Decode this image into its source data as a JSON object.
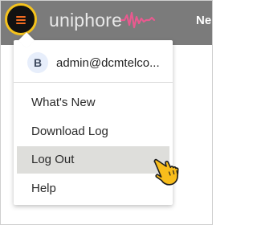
{
  "app": {
    "logo_text": "uniphore",
    "nav_partial": "Ne"
  },
  "user": {
    "avatar_initial": "B",
    "email": "admin@dcmtelco..."
  },
  "menu": {
    "items": [
      {
        "label": "What's New"
      },
      {
        "label": "Download Log"
      },
      {
        "label": "Log Out",
        "highlighted": true
      },
      {
        "label": "Help"
      }
    ]
  },
  "colors": {
    "topbar": "#7b7b7b",
    "menu_button_bg": "#121212",
    "menu_button_ring": "#f4c21c",
    "menu_icon": "#f26b21",
    "logo_wave": "#e85a8f",
    "highlight": "#dededb"
  },
  "icons": {
    "menu": "hamburger-menu-icon",
    "wave": "waveform-icon",
    "cursor": "hand-pointer-icon"
  }
}
